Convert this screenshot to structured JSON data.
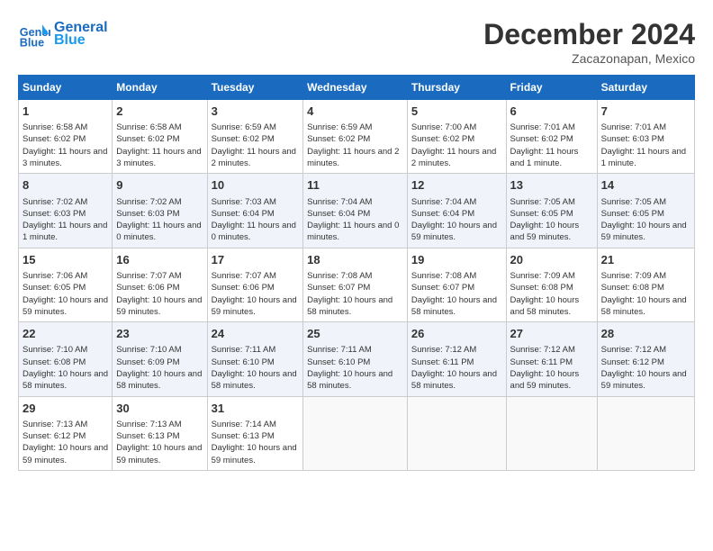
{
  "header": {
    "logo_line1": "General",
    "logo_line2": "Blue",
    "title": "December 2024",
    "subtitle": "Zacazonapan, Mexico"
  },
  "calendar": {
    "weekdays": [
      "Sunday",
      "Monday",
      "Tuesday",
      "Wednesday",
      "Thursday",
      "Friday",
      "Saturday"
    ],
    "weeks": [
      [
        {
          "day": "1",
          "info": "Sunrise: 6:58 AM\nSunset: 6:02 PM\nDaylight: 11 hours and 3 minutes."
        },
        {
          "day": "2",
          "info": "Sunrise: 6:58 AM\nSunset: 6:02 PM\nDaylight: 11 hours and 3 minutes."
        },
        {
          "day": "3",
          "info": "Sunrise: 6:59 AM\nSunset: 6:02 PM\nDaylight: 11 hours and 2 minutes."
        },
        {
          "day": "4",
          "info": "Sunrise: 6:59 AM\nSunset: 6:02 PM\nDaylight: 11 hours and 2 minutes."
        },
        {
          "day": "5",
          "info": "Sunrise: 7:00 AM\nSunset: 6:02 PM\nDaylight: 11 hours and 2 minutes."
        },
        {
          "day": "6",
          "info": "Sunrise: 7:01 AM\nSunset: 6:02 PM\nDaylight: 11 hours and 1 minute."
        },
        {
          "day": "7",
          "info": "Sunrise: 7:01 AM\nSunset: 6:03 PM\nDaylight: 11 hours and 1 minute."
        }
      ],
      [
        {
          "day": "8",
          "info": "Sunrise: 7:02 AM\nSunset: 6:03 PM\nDaylight: 11 hours and 1 minute."
        },
        {
          "day": "9",
          "info": "Sunrise: 7:02 AM\nSunset: 6:03 PM\nDaylight: 11 hours and 0 minutes."
        },
        {
          "day": "10",
          "info": "Sunrise: 7:03 AM\nSunset: 6:04 PM\nDaylight: 11 hours and 0 minutes."
        },
        {
          "day": "11",
          "info": "Sunrise: 7:04 AM\nSunset: 6:04 PM\nDaylight: 11 hours and 0 minutes."
        },
        {
          "day": "12",
          "info": "Sunrise: 7:04 AM\nSunset: 6:04 PM\nDaylight: 10 hours and 59 minutes."
        },
        {
          "day": "13",
          "info": "Sunrise: 7:05 AM\nSunset: 6:05 PM\nDaylight: 10 hours and 59 minutes."
        },
        {
          "day": "14",
          "info": "Sunrise: 7:05 AM\nSunset: 6:05 PM\nDaylight: 10 hours and 59 minutes."
        }
      ],
      [
        {
          "day": "15",
          "info": "Sunrise: 7:06 AM\nSunset: 6:05 PM\nDaylight: 10 hours and 59 minutes."
        },
        {
          "day": "16",
          "info": "Sunrise: 7:07 AM\nSunset: 6:06 PM\nDaylight: 10 hours and 59 minutes."
        },
        {
          "day": "17",
          "info": "Sunrise: 7:07 AM\nSunset: 6:06 PM\nDaylight: 10 hours and 59 minutes."
        },
        {
          "day": "18",
          "info": "Sunrise: 7:08 AM\nSunset: 6:07 PM\nDaylight: 10 hours and 58 minutes."
        },
        {
          "day": "19",
          "info": "Sunrise: 7:08 AM\nSunset: 6:07 PM\nDaylight: 10 hours and 58 minutes."
        },
        {
          "day": "20",
          "info": "Sunrise: 7:09 AM\nSunset: 6:08 PM\nDaylight: 10 hours and 58 minutes."
        },
        {
          "day": "21",
          "info": "Sunrise: 7:09 AM\nSunset: 6:08 PM\nDaylight: 10 hours and 58 minutes."
        }
      ],
      [
        {
          "day": "22",
          "info": "Sunrise: 7:10 AM\nSunset: 6:08 PM\nDaylight: 10 hours and 58 minutes."
        },
        {
          "day": "23",
          "info": "Sunrise: 7:10 AM\nSunset: 6:09 PM\nDaylight: 10 hours and 58 minutes."
        },
        {
          "day": "24",
          "info": "Sunrise: 7:11 AM\nSunset: 6:10 PM\nDaylight: 10 hours and 58 minutes."
        },
        {
          "day": "25",
          "info": "Sunrise: 7:11 AM\nSunset: 6:10 PM\nDaylight: 10 hours and 58 minutes."
        },
        {
          "day": "26",
          "info": "Sunrise: 7:12 AM\nSunset: 6:11 PM\nDaylight: 10 hours and 58 minutes."
        },
        {
          "day": "27",
          "info": "Sunrise: 7:12 AM\nSunset: 6:11 PM\nDaylight: 10 hours and 59 minutes."
        },
        {
          "day": "28",
          "info": "Sunrise: 7:12 AM\nSunset: 6:12 PM\nDaylight: 10 hours and 59 minutes."
        }
      ],
      [
        {
          "day": "29",
          "info": "Sunrise: 7:13 AM\nSunset: 6:12 PM\nDaylight: 10 hours and 59 minutes."
        },
        {
          "day": "30",
          "info": "Sunrise: 7:13 AM\nSunset: 6:13 PM\nDaylight: 10 hours and 59 minutes."
        },
        {
          "day": "31",
          "info": "Sunrise: 7:14 AM\nSunset: 6:13 PM\nDaylight: 10 hours and 59 minutes."
        },
        {
          "day": "",
          "info": ""
        },
        {
          "day": "",
          "info": ""
        },
        {
          "day": "",
          "info": ""
        },
        {
          "day": "",
          "info": ""
        }
      ]
    ]
  }
}
